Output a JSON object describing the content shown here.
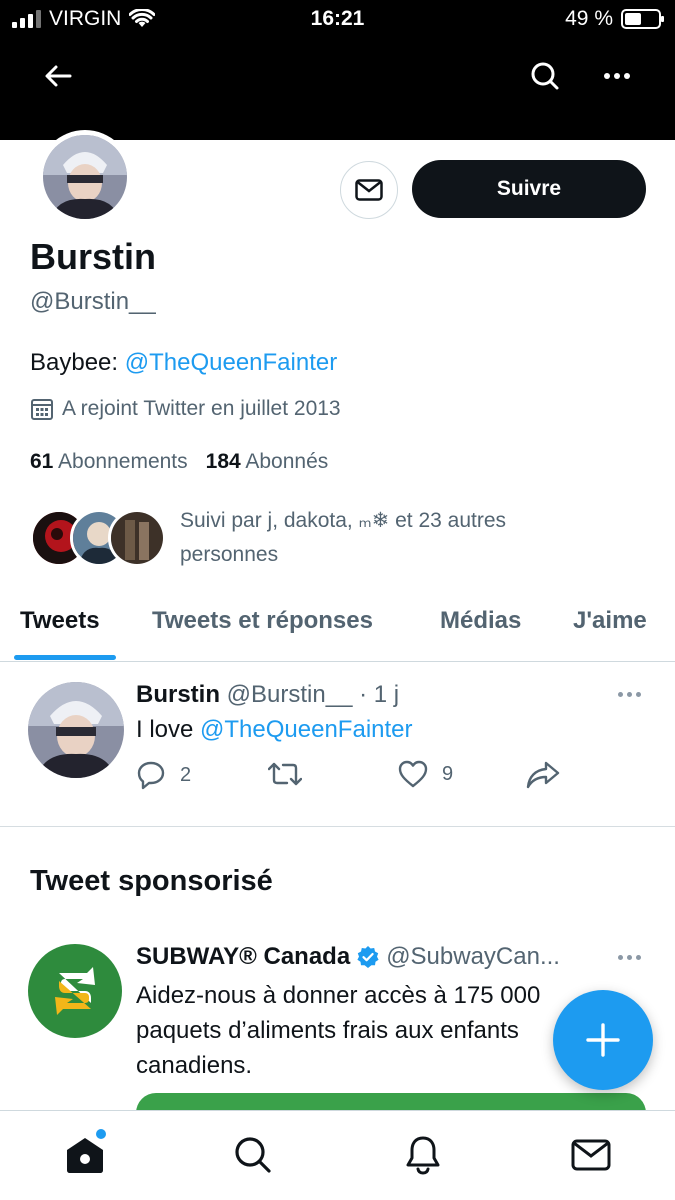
{
  "status_bar": {
    "carrier": "VIRGIN",
    "time": "16:21",
    "battery": "49 %"
  },
  "topbar": {
    "back_icon": "back-arrow-icon",
    "search_icon": "search-icon",
    "more_icon": "more-icon"
  },
  "profile": {
    "follow_label": "Suivre",
    "name": "Burstin",
    "handle": "@Burstin__",
    "bio_prefix": "Baybee: ",
    "bio_link": "@TheQueenFainter",
    "joined": "A rejoint Twitter en juillet 2013",
    "following_count": "61",
    "following_label": "Abonnements",
    "followers_count": "184",
    "followers_label": "Abonnés",
    "followed_by": "Suivi par j, dakota, ₘ❄ et 23 autres personnes"
  },
  "tabs": [
    {
      "label": "Tweets",
      "active": true
    },
    {
      "label": "Tweets et réponses",
      "active": false
    },
    {
      "label": "Médias",
      "active": false
    },
    {
      "label": "J'aime",
      "active": false
    }
  ],
  "tweet": {
    "name": "Burstin",
    "handle": "@Burstin__",
    "time": "· 1 j",
    "text_prefix": "I love ",
    "text_link": "@TheQueenFainter",
    "replies": "2",
    "retweets": "",
    "likes": "9"
  },
  "sponsored": {
    "title": "Tweet sponsorisé",
    "name": "SUBWAY® Canada",
    "handle": "@SubwayCan...",
    "text": "Aidez-nous à donner accès à 175 000 paquets d’aliments frais aux enfants canadiens.",
    "logo_letter": "S"
  },
  "colors": {
    "accent": "#1d9bf0",
    "text": "#0f1419",
    "muted": "#536471",
    "subway_green": "#2e8b3d",
    "subway_yellow": "#f2b619"
  },
  "bottom_nav": [
    "home-icon",
    "search-icon",
    "notifications-icon",
    "messages-icon"
  ]
}
